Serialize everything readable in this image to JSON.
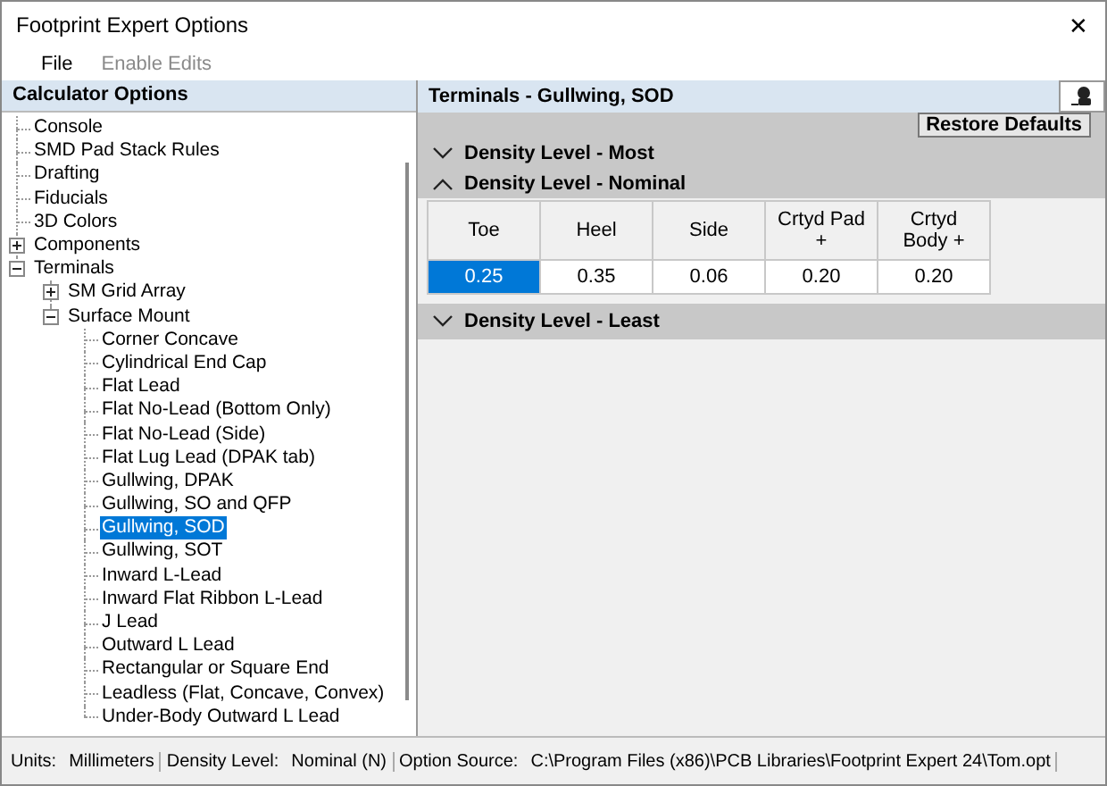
{
  "window": {
    "title": "Footprint Expert Options",
    "close": "✕"
  },
  "menu": [
    {
      "label": "File",
      "disabled": false
    },
    {
      "label": "Enable Edits",
      "disabled": true
    }
  ],
  "tree_panel": {
    "title": "Calculator Options",
    "items": [
      {
        "label": "Console",
        "selected": false
      },
      {
        "label": "SMD Pad Stack Rules",
        "selected": false
      },
      {
        "label": "Drafting",
        "selected": false
      },
      {
        "label": "Fiducials",
        "selected": false
      },
      {
        "label": "3D Colors",
        "selected": false
      },
      {
        "label": "Components",
        "selected": false,
        "expanded": false
      },
      {
        "label": "Terminals",
        "selected": false,
        "expanded": true,
        "children": [
          {
            "label": "SM Grid Array",
            "selected": false,
            "expanded": false
          },
          {
            "label": "Surface Mount",
            "selected": false,
            "expanded": true,
            "children": [
              {
                "label": "Corner Concave",
                "selected": false
              },
              {
                "label": "Cylindrical End Cap",
                "selected": false
              },
              {
                "label": "Flat Lead",
                "selected": false
              },
              {
                "label": "Flat No-Lead (Bottom Only)",
                "selected": false
              },
              {
                "label": "Flat No-Lead (Side)",
                "selected": false
              },
              {
                "label": "Flat Lug Lead (DPAK tab)",
                "selected": false
              },
              {
                "label": "Gullwing, DPAK",
                "selected": false
              },
              {
                "label": "Gullwing, SO and QFP",
                "selected": false
              },
              {
                "label": "Gullwing, SOD",
                "selected": true
              },
              {
                "label": "Gullwing, SOT",
                "selected": false
              },
              {
                "label": "Inward L-Lead",
                "selected": false
              },
              {
                "label": "Inward Flat Ribbon L-Lead",
                "selected": false
              },
              {
                "label": "J Lead",
                "selected": false
              },
              {
                "label": "Outward L Lead",
                "selected": false
              },
              {
                "label": "Rectangular or Square End",
                "selected": false
              },
              {
                "label": "Leadless (Flat, Concave, Convex)",
                "selected": false
              },
              {
                "label": "Under-Body Outward L Lead",
                "selected": false
              }
            ]
          }
        ]
      }
    ]
  },
  "detail_panel": {
    "title": "Terminals - Gullwing, SOD",
    "restore_button": "Restore Defaults",
    "sections": [
      {
        "title": "Density Level - Most",
        "expanded": false
      },
      {
        "title": "Density Level - Nominal",
        "expanded": true,
        "table": {
          "columns": [
            "Toe",
            "Heel",
            "Side",
            "Crtyd Pad +",
            "Crtyd Body +"
          ],
          "cells": [
            {
              "value": "0.25",
              "selected": true
            },
            {
              "value": "0.35",
              "selected": false
            },
            {
              "value": "0.06",
              "selected": false
            },
            {
              "value": "0.20",
              "selected": false
            },
            {
              "value": "0.20",
              "selected": false
            }
          ]
        }
      },
      {
        "title": "Density Level - Least",
        "expanded": false
      }
    ]
  },
  "status_bar": [
    {
      "label": "Units:",
      "value": "Millimeters"
    },
    {
      "label": "Density Level:",
      "value": "Nominal (N)"
    },
    {
      "label": "Option Source:",
      "value": "C:\\Program Files (x86)\\PCB Libraries\\Footprint Expert 24\\Tom.opt"
    }
  ]
}
